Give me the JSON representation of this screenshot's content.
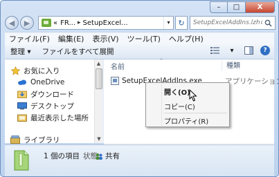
{
  "window": {
    "buttons": {
      "minimize": "–",
      "maximize": "□",
      "close": "X"
    }
  },
  "address_bar": {
    "prefix": "«",
    "segment1": "FR...",
    "segment2": "SetupExcel...",
    "separator": "▸",
    "dropdown": "▾",
    "refresh": "↻"
  },
  "search": {
    "placeholder": "SetupExcelAddIns.lzhの検索"
  },
  "menu": {
    "items": [
      "ファイル(F)",
      "編集(E)",
      "表示(V)",
      "ツール(T)",
      "ヘルプ(H)"
    ]
  },
  "toolbar": {
    "organize": "整理 ▾",
    "expand_all": "ファイルをすべて展開",
    "view_arrow": "▾"
  },
  "nav_pane": {
    "items": [
      {
        "label": "お気に入り",
        "icon": "star-icon"
      },
      {
        "label": "OneDrive",
        "icon": "cloud-icon"
      },
      {
        "label": "ダウンロード",
        "icon": "download-folder-icon"
      },
      {
        "label": "デスクトップ",
        "icon": "desktop-icon"
      },
      {
        "label": "最近表示した場所",
        "icon": "recent-places-icon"
      },
      {
        "label": "ライブラリ",
        "icon": "library-icon"
      }
    ]
  },
  "columns": {
    "name": "名前",
    "type": "種類",
    "sort_glyph": "^"
  },
  "files": [
    {
      "name": "SetupExcelAddIns.exe",
      "type": "アプリケーション"
    }
  ],
  "context_menu": {
    "items": [
      {
        "label": "開く(O)"
      },
      {
        "label": "コピー(C)"
      },
      {
        "label": "プロパティ(R)"
      }
    ]
  },
  "details": {
    "count": "1 個の項目",
    "status_label": "状態:",
    "status_value": "共有"
  },
  "colors": {
    "accent": "#2f6fc4",
    "archive_green": "#6cab3a"
  }
}
